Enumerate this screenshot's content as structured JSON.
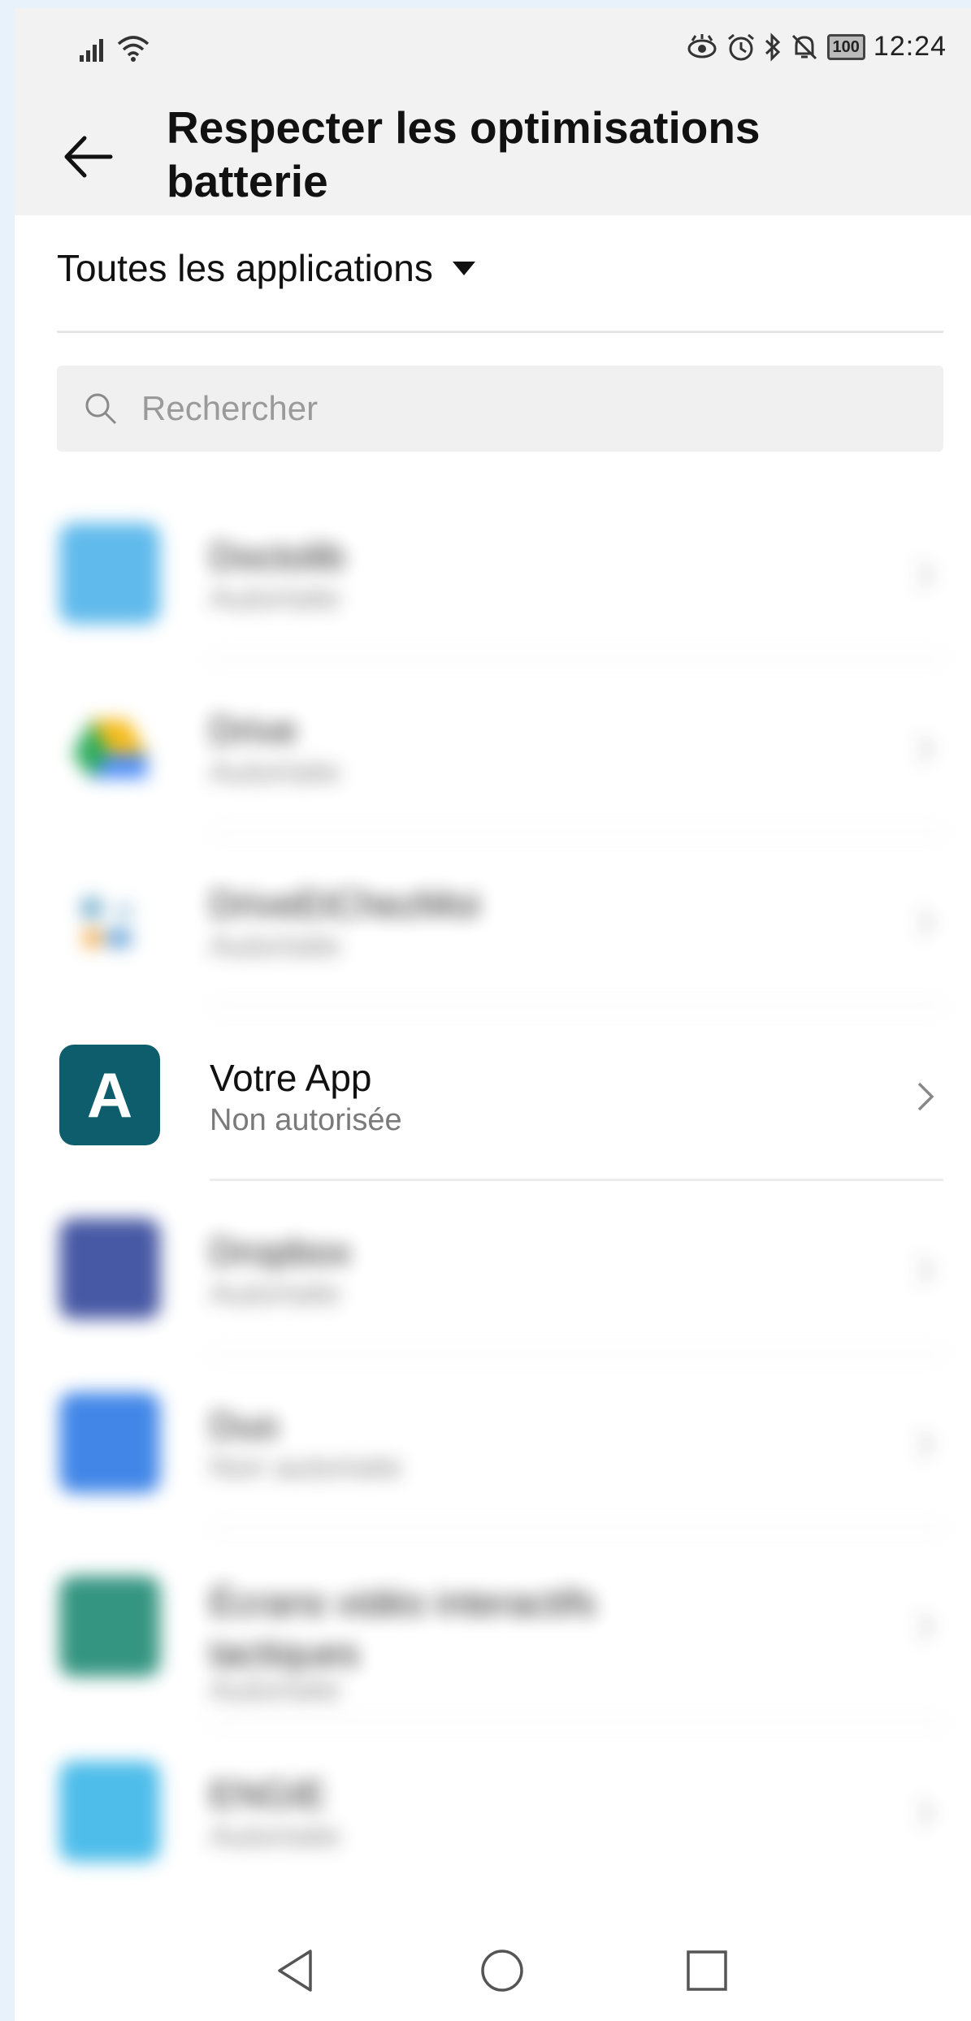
{
  "status_bar": {
    "time": "12:24",
    "battery": "100",
    "icons": [
      "signal-icon",
      "wifi-icon",
      "eye-comfort-icon",
      "alarm-icon",
      "bluetooth-icon",
      "mute-icon",
      "battery-icon"
    ]
  },
  "header": {
    "title": "Respecter les optimisations batterie",
    "back_icon": "back-arrow-icon"
  },
  "filter": {
    "label": "Toutes les applications"
  },
  "search": {
    "placeholder": "Rechercher"
  },
  "apps": [
    {
      "name": "Doctolib",
      "status": "Autorisée",
      "blurred": true,
      "color": "#4fb3ea"
    },
    {
      "name": "Drive",
      "status": "Autorisée",
      "blurred": true,
      "color": "#3aa757"
    },
    {
      "name": "DriveEtChezMoi",
      "status": "Autorisée",
      "blurred": true,
      "color": "#6aa8c9"
    },
    {
      "name": "Votre App",
      "status": "Non autorisée",
      "blurred": false,
      "icon_letter": "A",
      "color": "#0e5d6d"
    },
    {
      "name": "Dropbox",
      "status": "Autorisée",
      "blurred": true,
      "color": "#34479b"
    },
    {
      "name": "Duo",
      "status": "Non autorisée",
      "blurred": true,
      "color": "#2e7ae6"
    },
    {
      "name": "Écrans vidéo interactifs tactiques",
      "status": "Autorisée",
      "blurred": true,
      "color": "#1f8a74"
    },
    {
      "name": "ENGIE",
      "status": "Autorisée",
      "blurred": true,
      "color": "#3bb6e8"
    }
  ],
  "navbar": {
    "back": "nav-back-icon",
    "home": "nav-home-icon",
    "recents": "nav-recents-icon"
  }
}
